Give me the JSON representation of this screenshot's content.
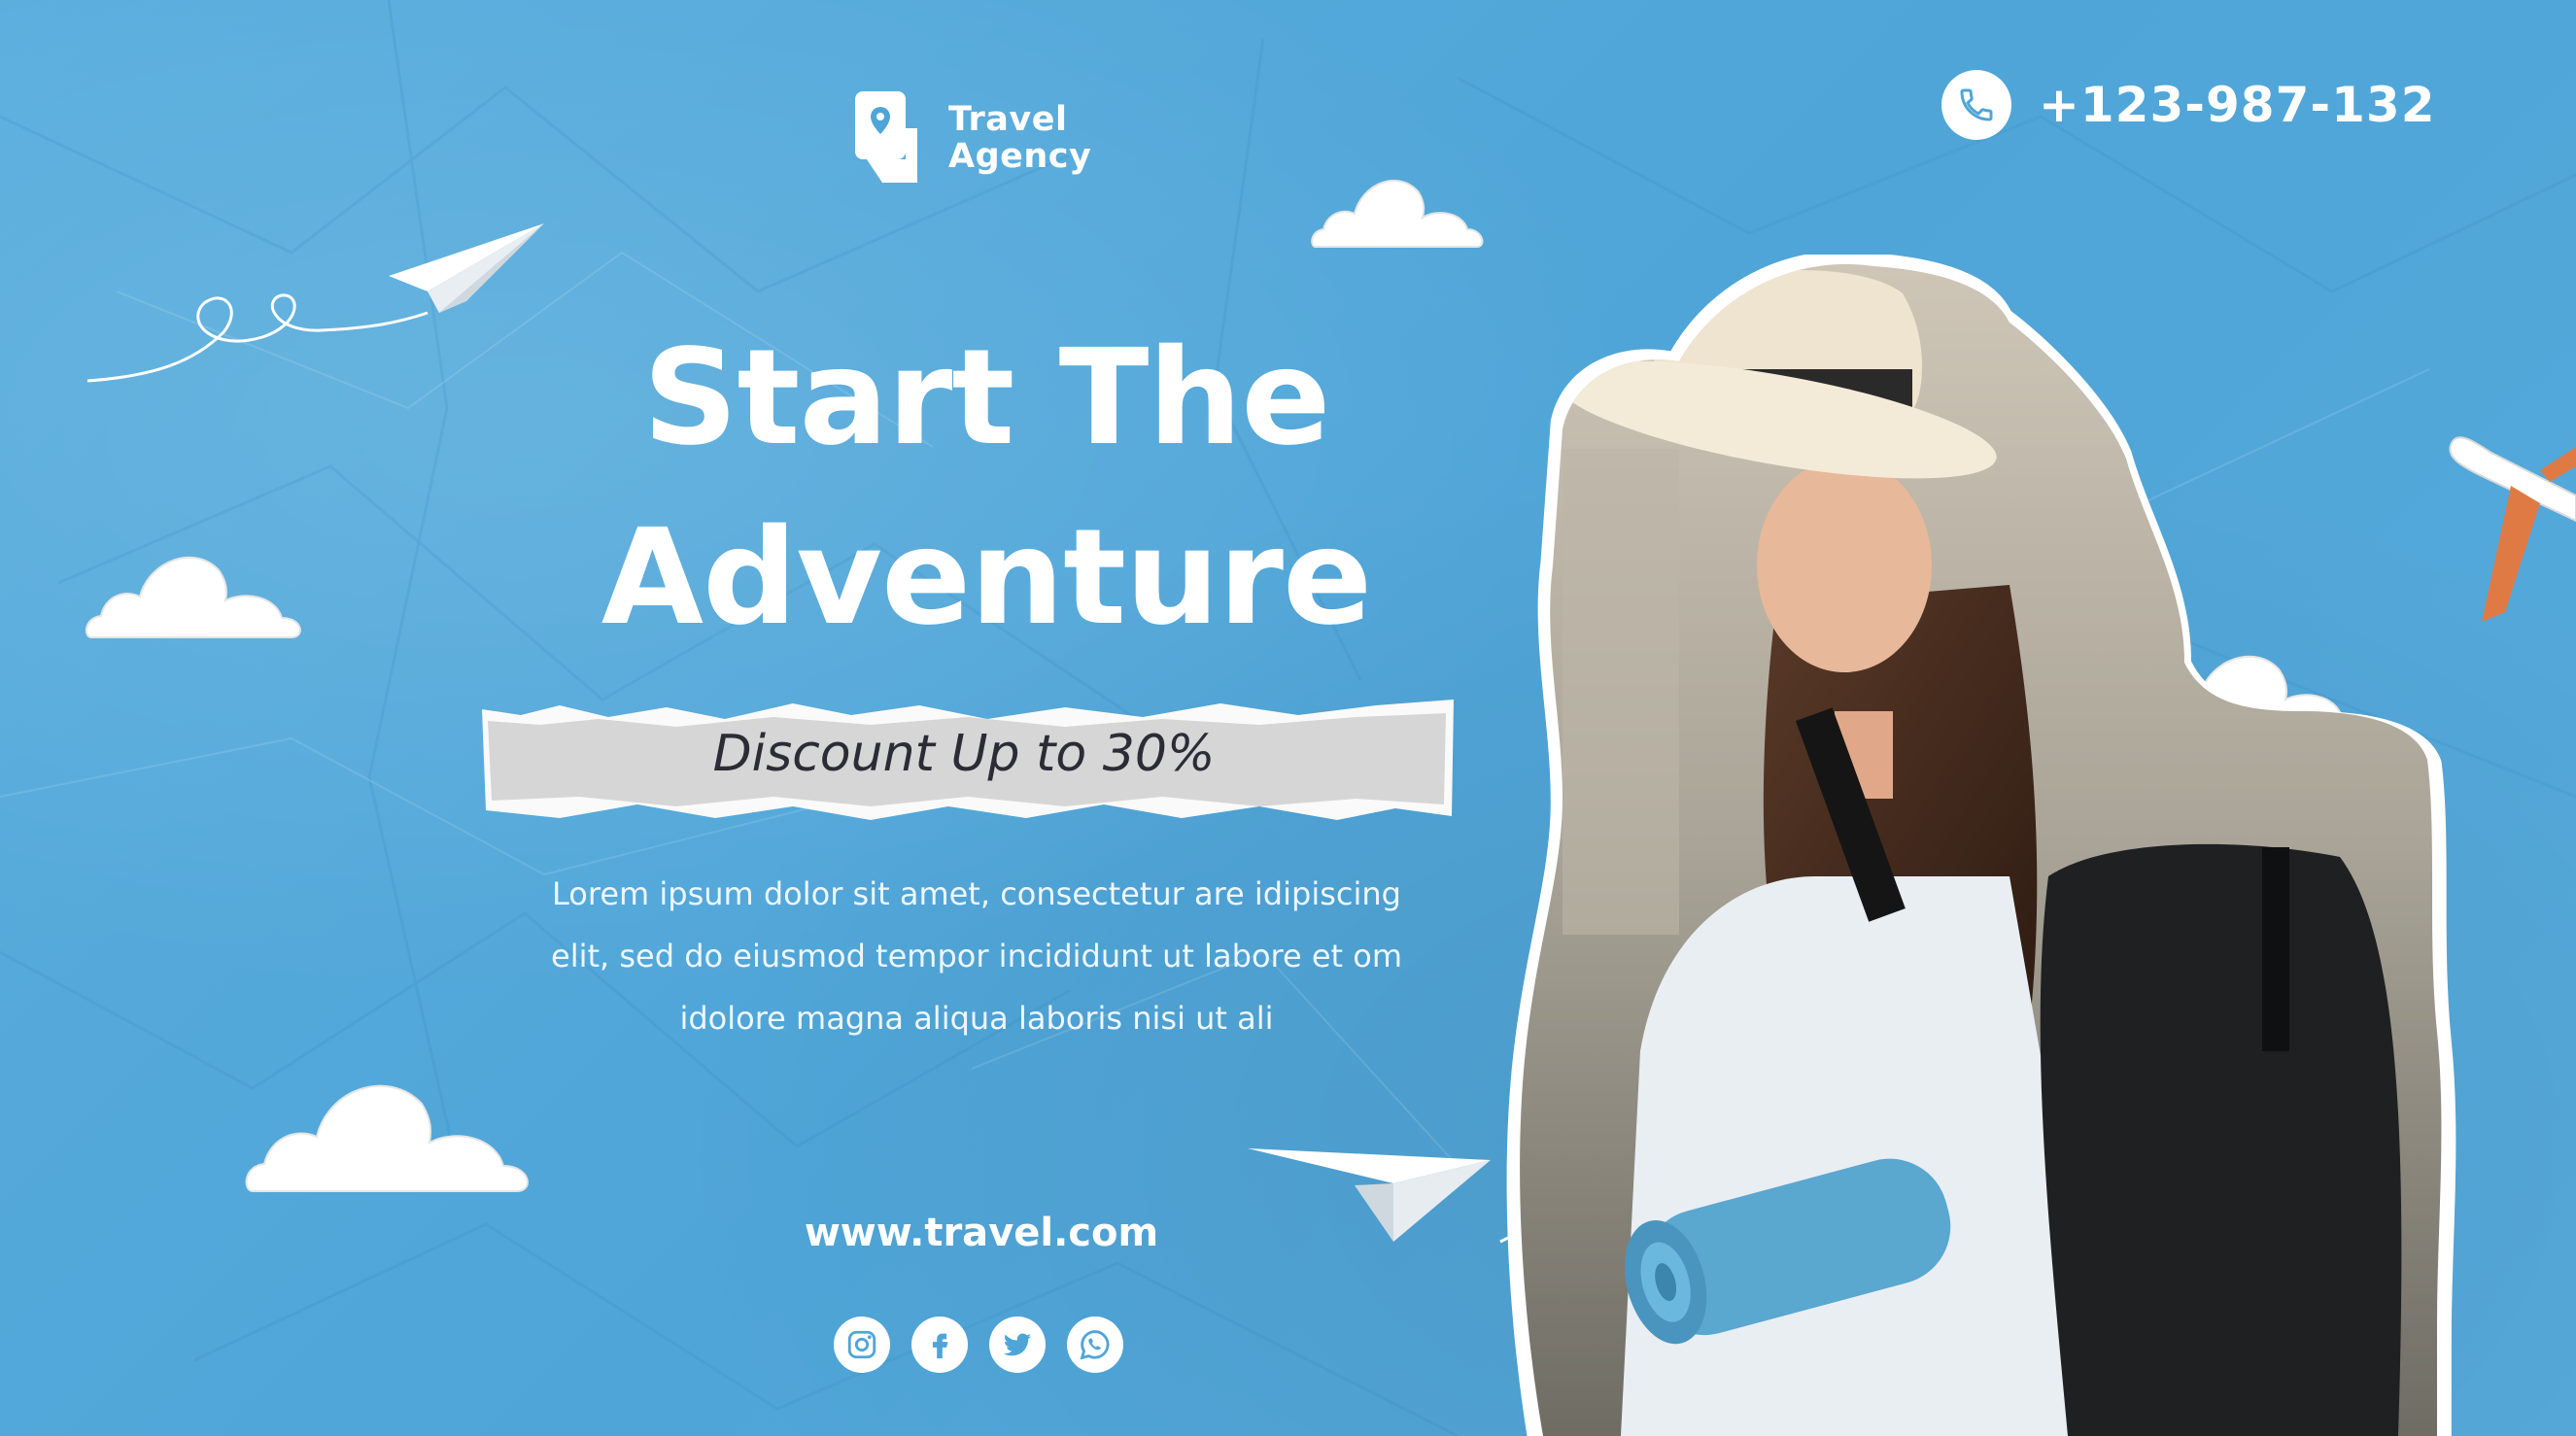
{
  "brand": {
    "line1": "Travel",
    "line2": "Agency"
  },
  "contact": {
    "phone": "+123-987-132"
  },
  "headline": {
    "line1": "Start The",
    "line2": "Adventure"
  },
  "promo": {
    "discount": "Discount Up to 30%"
  },
  "description": {
    "line1": "Lorem ipsum dolor sit amet, consectetur are  idipiscing",
    "line2": "elit, sed do eiusmod tempor incididunt ut labore et  om",
    "line3": "idolore magna aliqua laboris nisi ut ali"
  },
  "website": "www.travel.com",
  "socials": [
    "instagram-icon",
    "facebook-icon",
    "twitter-icon",
    "whatsapp-icon"
  ],
  "colors": {
    "background": "#4fa5d8",
    "text": "#ffffff",
    "accent_orange": "#e07a45",
    "icon_blue": "#4fa5d8"
  }
}
